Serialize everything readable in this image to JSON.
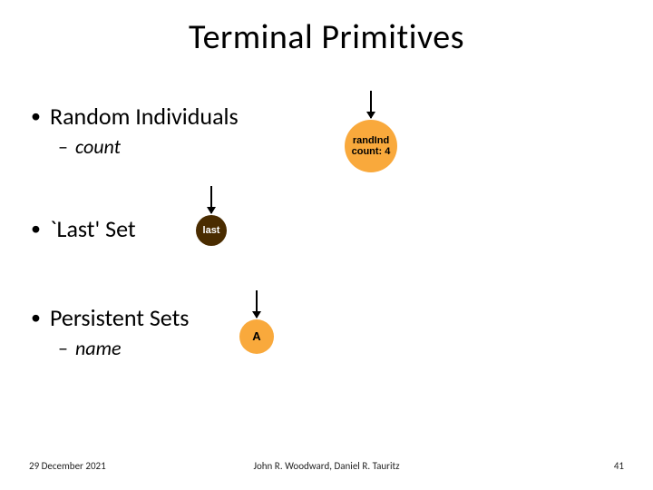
{
  "title": "Terminal Primitives",
  "items": {
    "random": {
      "label": "Random Individuals",
      "sub": "count",
      "node": {
        "line1": "randInd",
        "line2": "count: 4"
      }
    },
    "last": {
      "label": "`Last' Set",
      "node": {
        "text": "last"
      }
    },
    "persistent": {
      "label": "Persistent Sets",
      "sub": "name",
      "node": {
        "text": "A"
      }
    }
  },
  "footer": {
    "date": "29 December 2021",
    "authors": "John R. Woodward, Daniel R. Tauritz",
    "page": "41"
  }
}
